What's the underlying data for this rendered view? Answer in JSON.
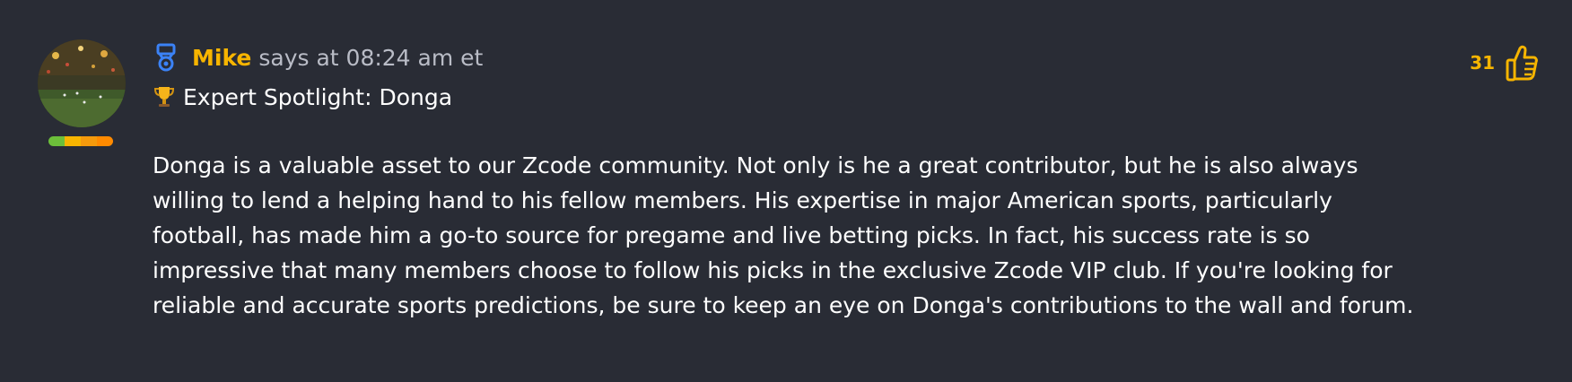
{
  "post": {
    "author": "Mike",
    "meta": "says at 08:24 am et",
    "subtitle": "Expert Spotlight: Donga",
    "body": "Donga is a valuable asset to our Zcode community. Not only is he a great contributor, but he is also always willing to lend a helping hand to his fellow members. His expertise in major American sports, particularly football, has made him a go-to source for pregame and live betting picks. In fact, his success rate is so impressive that many members choose to follow his picks in the exclusive Zcode VIP club. If you're looking for reliable and accurate sports predictions, be sure to keep an eye on Donga's contributions to the wall and forum.",
    "likes": "31"
  },
  "icons": {
    "badge": "medal-badge-icon",
    "subtitle": "trophy-icon",
    "like": "thumbs-up-icon"
  },
  "colors": {
    "background": "#292c35",
    "author": "#f7b500",
    "meta_text": "#b9bcc6",
    "body_text": "#ffffff",
    "badge_blue": "#3b82f6",
    "level_segments": [
      "#6cbf3a",
      "#f7b500",
      "#f59a0c",
      "#ff8a00"
    ]
  }
}
